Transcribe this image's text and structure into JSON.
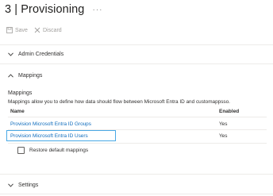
{
  "header": {
    "title": "3 | Provisioning",
    "more": "···"
  },
  "toolbar": {
    "save_label": "Save",
    "discard_label": "Discard"
  },
  "sections": {
    "admin_credentials": "Admin Credentials",
    "mappings": "Mappings",
    "settings": "Settings"
  },
  "mappings": {
    "heading": "Mappings",
    "description": "Mappings allow you to define how data should flow between Microsoft Entra ID and customappsso.",
    "columns": {
      "name": "Name",
      "enabled": "Enabled"
    },
    "rows": [
      {
        "name": "Provision Microsoft Entra ID Groups",
        "enabled": "Yes"
      },
      {
        "name": "Provision Microsoft Entra ID Users",
        "enabled": "Yes"
      }
    ],
    "restore_label": "Restore default mappings"
  },
  "colors": {
    "link": "#0f6cbd",
    "focus": "#4aa9e6",
    "divider": "#edebe9"
  }
}
